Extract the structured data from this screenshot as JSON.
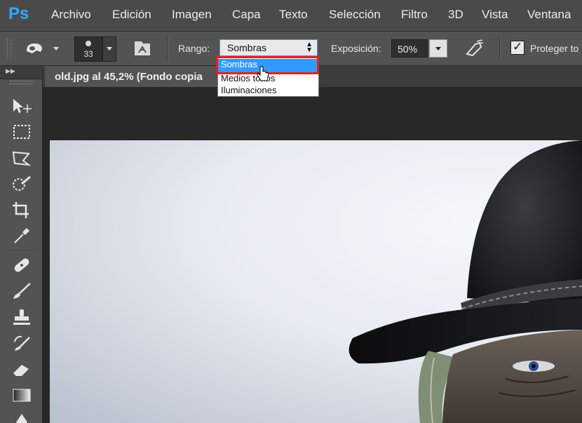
{
  "app": {
    "logo": "Ps"
  },
  "menu": {
    "items": [
      {
        "label": "Archivo"
      },
      {
        "label": "Edición"
      },
      {
        "label": "Imagen"
      },
      {
        "label": "Capa"
      },
      {
        "label": "Texto"
      },
      {
        "label": "Selección"
      },
      {
        "label": "Filtro"
      },
      {
        "label": "3D"
      },
      {
        "label": "Vista"
      },
      {
        "label": "Ventana"
      }
    ]
  },
  "options": {
    "brush_size": "33",
    "rango_label": "Rango:",
    "rango_value": "Sombras",
    "exposicion_label": "Exposición:",
    "exposicion_value": "50%",
    "proteger_label": "Proteger to",
    "proteger_checked": true
  },
  "dropdown": {
    "options": [
      {
        "label": "Sombras",
        "selected": true
      },
      {
        "label": "Medios tonos",
        "selected": false
      },
      {
        "label": "Iluminaciones",
        "selected": false
      }
    ]
  },
  "document": {
    "tab_title": "old.jpg al 45,2% (Fondo copia"
  },
  "toolbox": {
    "tools": [
      {
        "icon": "move-icon"
      },
      {
        "icon": "marquee-icon"
      },
      {
        "icon": "lasso-icon"
      },
      {
        "icon": "quick-selection-icon"
      },
      {
        "icon": "crop-icon"
      },
      {
        "icon": "eyedropper-icon"
      },
      {
        "icon": "healing-brush-icon"
      },
      {
        "icon": "brush-icon"
      },
      {
        "icon": "clone-stamp-icon"
      },
      {
        "icon": "history-brush-icon"
      },
      {
        "icon": "eraser-icon"
      },
      {
        "icon": "gradient-icon"
      },
      {
        "icon": "blur-icon"
      }
    ]
  },
  "colors": {
    "highlight": "#e2231a",
    "selection": "#3399ff",
    "ps_blue": "#31a8ff"
  }
}
